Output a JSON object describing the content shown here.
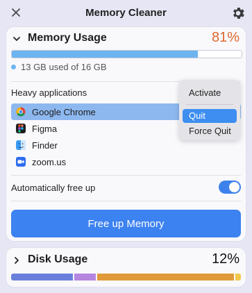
{
  "header": {
    "title": "Memory Cleaner"
  },
  "memory": {
    "title": "Memory Usage",
    "percent_text": "81%",
    "fill_fraction": 0.81,
    "bar_color": "#6cb4f0",
    "usage_text": "13 GB used of 16 GB",
    "heavy_label": "Heavy applications",
    "apps": [
      {
        "name": "Google Chrome",
        "icon": "chrome-icon",
        "selected": true
      },
      {
        "name": "Figma",
        "icon": "figma-icon",
        "selected": false
      },
      {
        "name": "Finder",
        "icon": "finder-icon",
        "selected": false
      },
      {
        "name": "zoom.us",
        "icon": "zoom-icon",
        "selected": false
      }
    ],
    "auto_free_label": "Automatically free up",
    "auto_free_on": true,
    "free_button_label": "Free up Memory"
  },
  "context_menu": {
    "items": [
      "Activate",
      "Quit",
      "Force Quit"
    ],
    "highlighted": "Quit"
  },
  "disk": {
    "title": "Disk Usage",
    "percent_text": "12%",
    "segments": [
      {
        "fraction": 0.275,
        "color": "#6a7fdc"
      },
      {
        "fraction": 0.095,
        "color": "#b585e0"
      },
      {
        "fraction": 0.605,
        "color": "#e09a3a"
      },
      {
        "fraction": 0.025,
        "color": "#f1c84a"
      }
    ]
  },
  "colors": {
    "accent": "#3c82f0",
    "warning": "#e0682e",
    "background": "#e6e6f4"
  }
}
